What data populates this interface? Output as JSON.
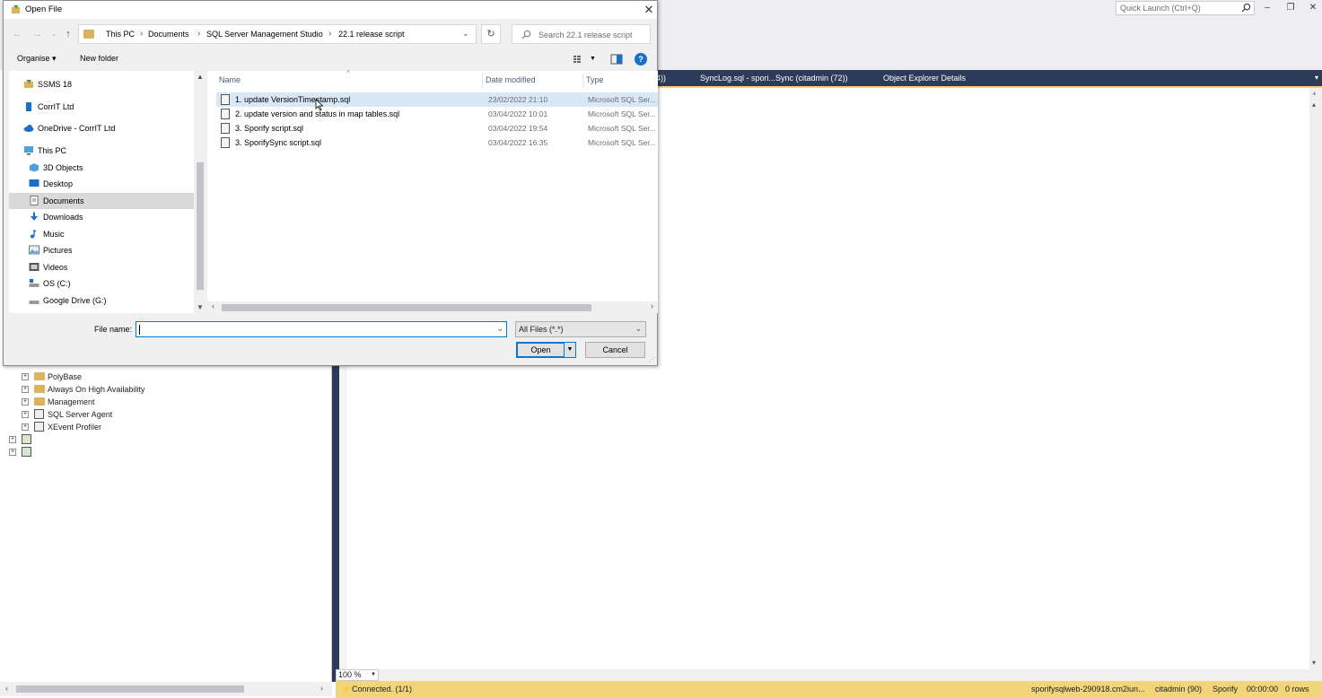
{
  "background_app": {
    "quick_launch_placeholder": "Quick Launch (Ctrl+Q)",
    "window_controls": {
      "minimize": "–",
      "restore": "❐",
      "close": "✕"
    },
    "tabs": [
      {
        "label": "4))"
      },
      {
        "label": "SyncLog.sql - spori...Sync (citadmin (72))"
      },
      {
        "label": "Object Explorer Details"
      }
    ],
    "object_explorer": {
      "items": [
        {
          "label": "PolyBase",
          "icon": "folder-icon"
        },
        {
          "label": "Always On High Availability",
          "icon": "folder-icon"
        },
        {
          "label": "Management",
          "icon": "folder-icon"
        },
        {
          "label": "SQL Server Agent",
          "icon": "agent-icon"
        },
        {
          "label": "XEvent Profiler",
          "icon": "profiler-icon"
        },
        {
          "label": "",
          "icon": "server-icon"
        },
        {
          "label": "",
          "icon": "server-icon"
        }
      ]
    },
    "editor": {
      "zoom": "100 %"
    },
    "status_bar": {
      "connected": "Connected. (1/1)",
      "server": "sporifysqlweb-290918.cm2iun...",
      "user": "citadmin (90)",
      "database": "Sporify",
      "elapsed": "00:00:00",
      "rows": "0 rows"
    },
    "colors": {
      "tab_strip": "#2d3b5a",
      "status_bar": "#f2d47a"
    }
  },
  "dialog": {
    "title": "Open File",
    "close": "✕",
    "nav": {
      "back": "←",
      "forward": "→",
      "recent": "⌄",
      "up": "↑"
    },
    "breadcrumb": [
      "This PC",
      "Documents",
      "SQL Server Management Studio",
      "22.1 release script"
    ],
    "search_placeholder": "Search 22.1 release script",
    "toolbar": {
      "organise": "Organise ▾",
      "new_folder": "New folder",
      "help": "?"
    },
    "nav_pane": [
      {
        "label": "SSMS 18",
        "icon": "ssms-icon"
      },
      {
        "label": "CorrIT Ltd",
        "icon": "building-icon"
      },
      {
        "label": "OneDrive - CorrIT Ltd",
        "icon": "cloud-icon"
      },
      {
        "label": "This PC",
        "icon": "pc-icon"
      },
      {
        "label": "3D Objects",
        "icon": "cube-icon"
      },
      {
        "label": "Desktop",
        "icon": "desktop-icon"
      },
      {
        "label": "Documents",
        "icon": "document-icon",
        "selected": true
      },
      {
        "label": "Downloads",
        "icon": "download-icon"
      },
      {
        "label": "Music",
        "icon": "music-icon"
      },
      {
        "label": "Pictures",
        "icon": "picture-icon"
      },
      {
        "label": "Videos",
        "icon": "video-icon"
      },
      {
        "label": "OS (C:)",
        "icon": "drive-icon"
      },
      {
        "label": "Google Drive (G:)",
        "icon": "drive-icon"
      }
    ],
    "columns": {
      "name": "Name",
      "date": "Date modified",
      "type": "Type"
    },
    "files": [
      {
        "name": "1. update VersionTimestamp.sql",
        "date": "23/02/2022 21:10",
        "type": "Microsoft SQL Ser..."
      },
      {
        "name": "2. update version and status in map tables.sql",
        "date": "03/04/2022 10:01",
        "type": "Microsoft SQL Ser..."
      },
      {
        "name": "3. Sporify script.sql",
        "date": "03/04/2022 19:54",
        "type": "Microsoft SQL Ser..."
      },
      {
        "name": "3. SporifySync script.sql",
        "date": "03/04/2022 16:35",
        "type": "Microsoft SQL Ser..."
      }
    ],
    "file_name_label": "File name:",
    "file_name_value": "",
    "filter_value": "All Files (*.*)",
    "open_label": "Open",
    "cancel_label": "Cancel"
  }
}
